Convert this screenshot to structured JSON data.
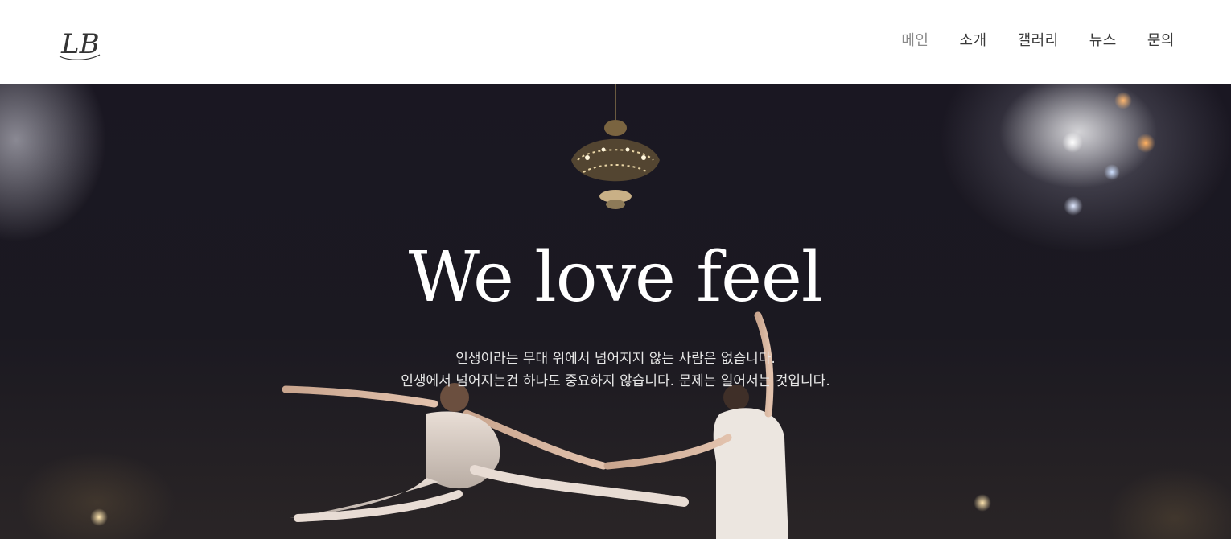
{
  "header": {
    "logo_text": "LB",
    "nav": [
      {
        "label": "메인",
        "active": true
      },
      {
        "label": "소개",
        "active": false
      },
      {
        "label": "갤러리",
        "active": false
      },
      {
        "label": "뉴스",
        "active": false
      },
      {
        "label": "문의",
        "active": false
      }
    ]
  },
  "hero": {
    "title": "We love feel",
    "subtitle_line1": "인생이라는 무대 위에서 넘어지지 않는 사람은 없습니다.",
    "subtitle_line2": "인생에서 넘어지는건 하나도 중요하지 않습니다. 문제는 일어서는 것입니다."
  },
  "colors": {
    "header_bg": "#ffffff",
    "nav_text": "#3a3a3a",
    "nav_active": "#8a8a8a",
    "hero_bg": "#1b1921",
    "hero_text": "#ffffff"
  }
}
